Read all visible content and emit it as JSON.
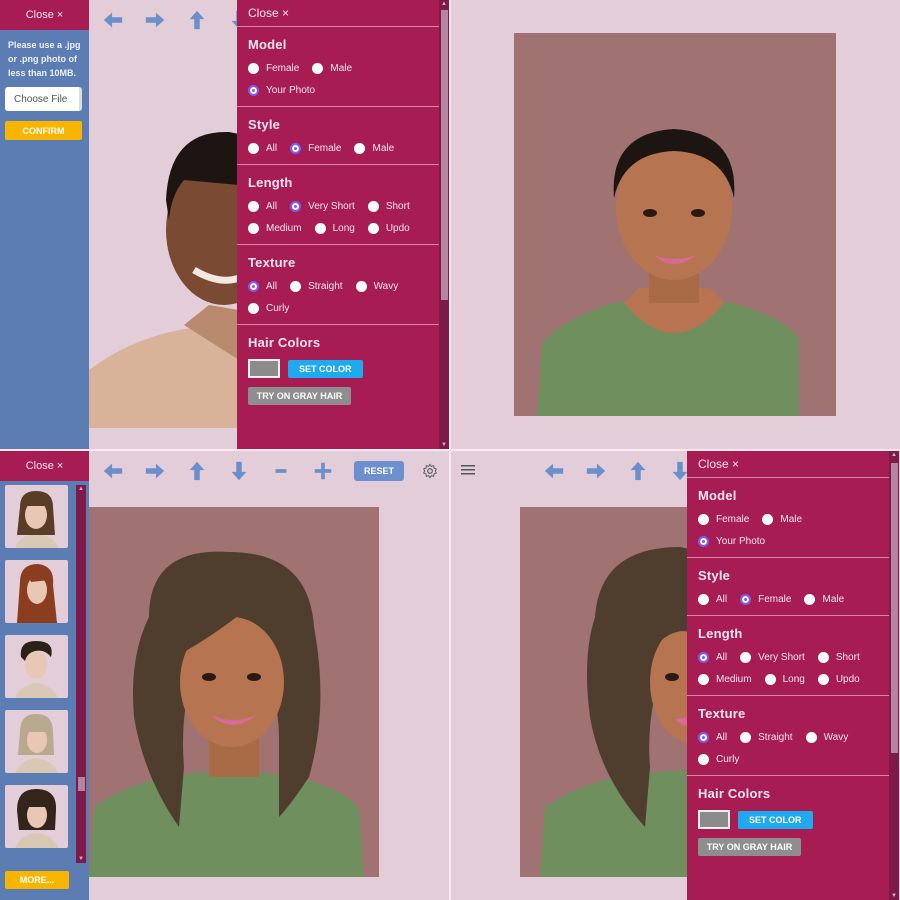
{
  "colors": {
    "panel": "#a81c54",
    "sidebar": "#5b7db4",
    "background": "#e2cdd8",
    "photo_bg": "#a07272",
    "confirm": "#f7b500",
    "set_color": "#1fa9ef",
    "radio_selected": "#7d5cf2",
    "swatch": "#8b8b8b"
  },
  "upload_panel": {
    "close_label": "Close ×",
    "note": "Please use a .jpg or .png photo of less than 10MB.",
    "file_button": "Choose File",
    "confirm_label": "CONFIRM"
  },
  "toolbar": {
    "icons": [
      "arrow-left-icon",
      "arrow-right-icon",
      "arrow-up-icon",
      "arrow-down-icon",
      "minus-icon",
      "plus-icon"
    ],
    "reset_label": "RESET",
    "settings_icon": "gear-icon",
    "menu_icon": "hamburger-icon"
  },
  "filters": {
    "close_label": "Close ×",
    "model": {
      "title": "Model",
      "options": [
        "Female",
        "Male",
        "Your Photo"
      ],
      "selected": "Your Photo"
    },
    "style": {
      "title": "Style",
      "options": [
        "All",
        "Female",
        "Male"
      ],
      "selected": "Female"
    },
    "length": {
      "title": "Length",
      "options": [
        "All",
        "Very Short",
        "Short",
        "Medium",
        "Long",
        "Updo"
      ],
      "selected_top": "Very Short",
      "selected_bottom": "All"
    },
    "texture": {
      "title": "Texture",
      "options": [
        "All",
        "Straight",
        "Wavy",
        "Curly"
      ],
      "selected": "All"
    },
    "hair_colors": {
      "title": "Hair Colors",
      "set_color_label": "SET COLOR",
      "gray_label": "TRY ON GRAY HAIR"
    }
  },
  "gallery": {
    "close_label": "Close ×",
    "items": [
      {
        "name": "brown-wavy-bangs",
        "hair": "#5a3d26"
      },
      {
        "name": "auburn-long",
        "hair": "#8a3d1f"
      },
      {
        "name": "dark-curly-short",
        "hair": "#2c2119"
      },
      {
        "name": "blonde-bob",
        "hair": "#b8a98f"
      },
      {
        "name": "dark-curly-medium",
        "hair": "#33251a"
      }
    ],
    "more_label": "MORE..."
  }
}
